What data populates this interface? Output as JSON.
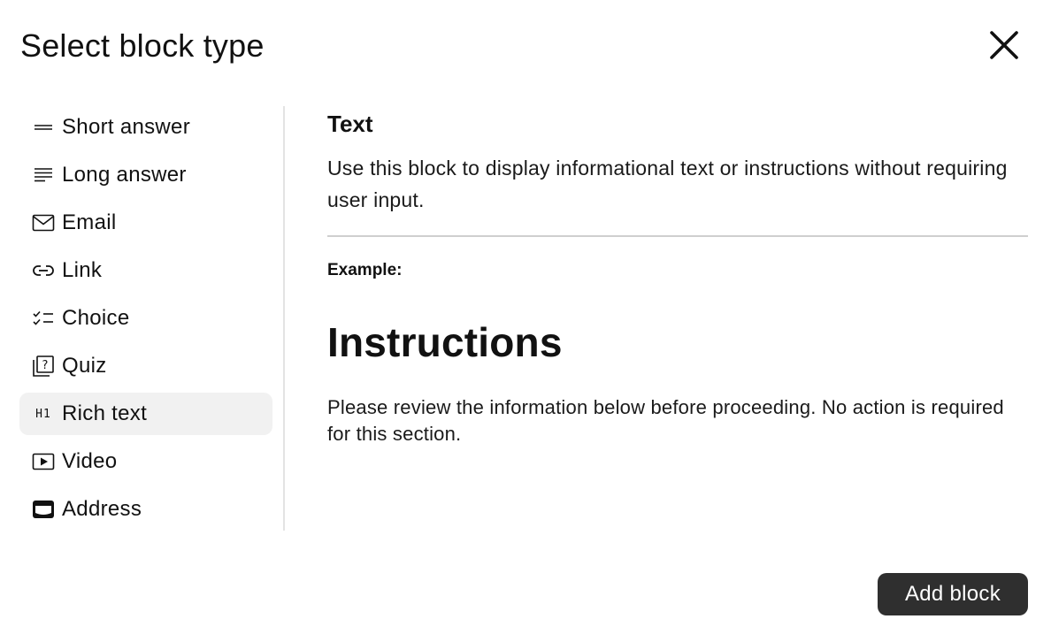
{
  "dialog": {
    "title": "Select block type",
    "close_icon": "close-icon"
  },
  "sidebar": {
    "items": [
      {
        "label": "Short answer",
        "icon": "short-answer-icon",
        "selected": false
      },
      {
        "label": "Long answer",
        "icon": "long-answer-icon",
        "selected": false
      },
      {
        "label": "Email",
        "icon": "email-icon",
        "selected": false
      },
      {
        "label": "Link",
        "icon": "link-icon",
        "selected": false
      },
      {
        "label": "Choice",
        "icon": "choice-icon",
        "selected": false
      },
      {
        "label": "Quiz",
        "icon": "quiz-icon",
        "selected": false
      },
      {
        "label": "Rich text",
        "icon": "heading-icon",
        "icon_text": "H1",
        "selected": true
      },
      {
        "label": "Video",
        "icon": "video-icon",
        "selected": false
      },
      {
        "label": "Address",
        "icon": "address-icon",
        "selected": false
      }
    ]
  },
  "detail": {
    "title": "Text",
    "description": "Use this block to display informational text or instructions without requiring user input.",
    "example_label": "Example:",
    "example_heading": "Instructions",
    "example_body": "Please review the information below before proceeding. No action is required for this section."
  },
  "footer": {
    "add_label": "Add block"
  },
  "colors": {
    "selected_bg": "#f1f1f1",
    "primary_button": "#2f2f2f",
    "divider": "#cfcfcf"
  }
}
